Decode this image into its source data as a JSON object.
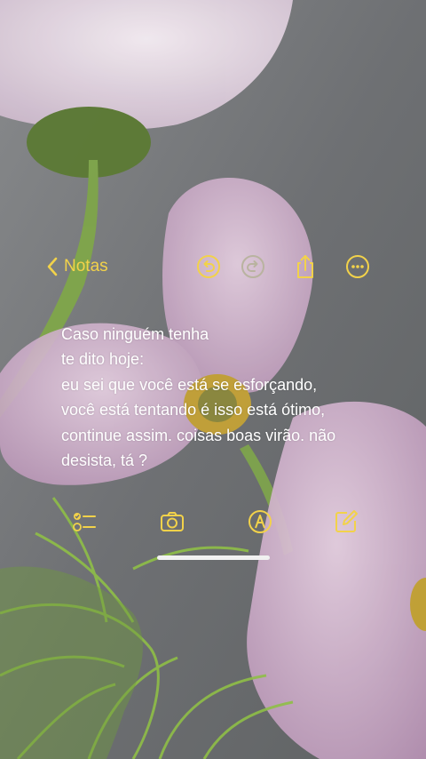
{
  "nav": {
    "back_label": "Notas"
  },
  "toolbar": {
    "icons": [
      "undo-icon",
      "redo-icon",
      "share-icon",
      "more-icon"
    ]
  },
  "note": {
    "text": "Caso ninguém tenha\nte dito hoje:\neu sei que você está se esforçando,\nvocê está tentando é isso está ótimo,\ncontinue assim. coisas boas virão. não\ndesista, tá ?"
  },
  "bottom_toolbar": {
    "icons": [
      "checklist-icon",
      "camera-icon",
      "markup-icon",
      "compose-icon"
    ]
  },
  "colors": {
    "accent": "#f2d24a",
    "text": "#ffffff",
    "disabled": "#b9b3a0"
  }
}
